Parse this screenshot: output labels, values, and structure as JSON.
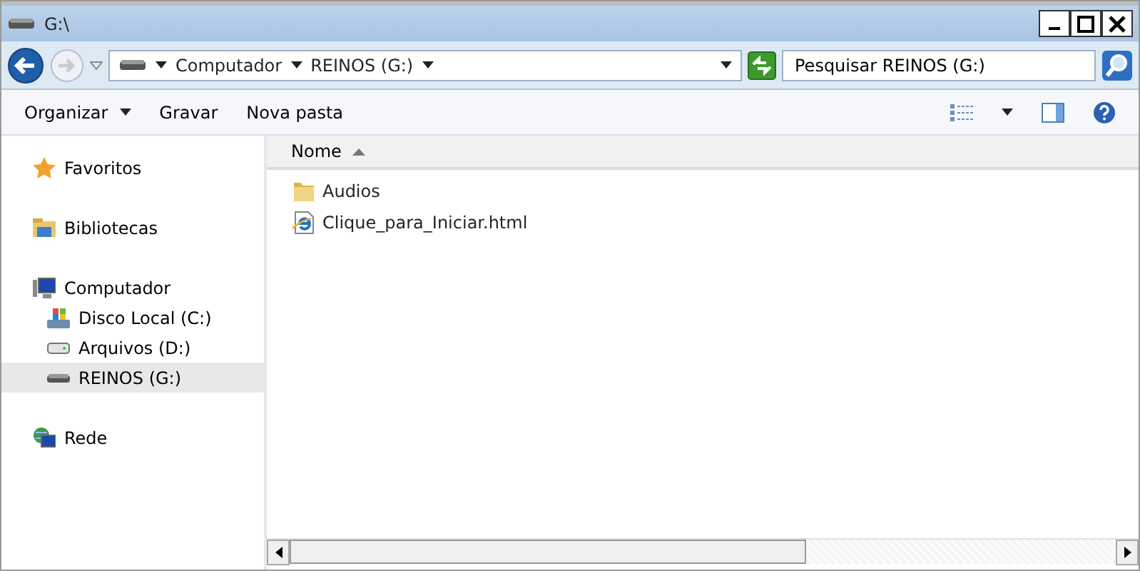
{
  "window": {
    "title": "G:\\"
  },
  "address": {
    "crumbs": [
      "Computador",
      "REINOS (G:)"
    ]
  },
  "search": {
    "placeholder": "Pesquisar REINOS (G:)"
  },
  "toolbar": [
    {
      "label": "Organizar",
      "kind": "menu"
    },
    {
      "label": "Gravar",
      "kind": "button"
    },
    {
      "label": "Nova pasta",
      "kind": "button"
    }
  ],
  "sidebar": {
    "items": [
      {
        "label": "Favoritos",
        "kind": "star",
        "selected": false
      },
      {
        "label": "Bibliotecas",
        "kind": "library",
        "selected": false
      },
      {
        "label": "Computador",
        "kind": "computer",
        "selected": false,
        "children": [
          {
            "label": "Disco Local (C:)",
            "kind": "system-drive",
            "selected": false
          },
          {
            "label": "Arquivos (D:)",
            "kind": "drive",
            "selected": false
          },
          {
            "label": "REINOS (G:)",
            "kind": "usb-drive",
            "selected": true
          }
        ]
      },
      {
        "label": "Rede",
        "kind": "network",
        "selected": false
      }
    ]
  },
  "table": {
    "columns": [
      {
        "label": "Nome",
        "sorted": true
      }
    ],
    "rows": [
      {
        "name": "Audios",
        "kind": "folder"
      },
      {
        "name": "Clique_para_Iniciar.html",
        "kind": "html"
      }
    ]
  }
}
